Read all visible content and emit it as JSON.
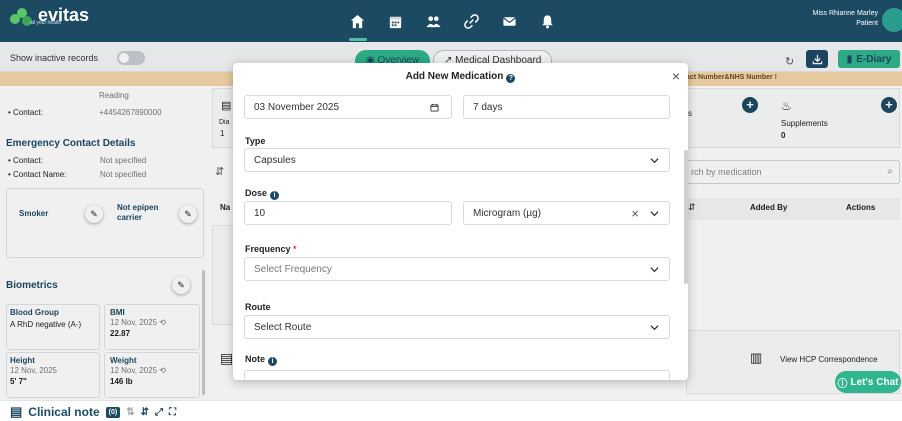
{
  "header": {
    "logo_text": "evitas",
    "logo_tagline": "all your health",
    "nav_icons": [
      "home-icon",
      "calendar-icon",
      "users-icon",
      "link-icon",
      "mail-icon",
      "bell-icon"
    ],
    "user_name": "Miss Rhianne Marley",
    "user_role": "Patient"
  },
  "subbar": {
    "inactive_label": "Show inactive records",
    "tab_overview": "Overview",
    "tab_medical": "Medical Dashboard",
    "ediary": "E-Diary"
  },
  "notice": {
    "text": "act Number&NHS Number !"
  },
  "left_panel": {
    "city": "Reading",
    "contact_label": "Contact:",
    "contact_value": "+4454267890000",
    "emergency_title": "Emergency Contact Details",
    "ec_contact_label": "Contact:",
    "ec_contact_value": "Not specified",
    "ec_name_label": "Contact Name:",
    "ec_name_value": "Not specified",
    "smoker": "Smoker",
    "epipen": "Not epipen carrier",
    "biometrics_title": "Biometrics",
    "blood_group_label": "Blood Group",
    "blood_group_value": "A RhD negative (A-)",
    "bmi_label": "BMI",
    "bmi_date": "12 Nov, 2025",
    "bmi_value": "22.87",
    "height_label": "Height",
    "height_date": "12 Nov, 2025",
    "height_value": "5' 7\"",
    "weight_label": "Weight",
    "weight_date": "12 Nov, 2025",
    "weight_value": "146 lb"
  },
  "middle_partial": {
    "dia": "Dia",
    "one": "1",
    "na": "Na"
  },
  "right_panel": {
    "s_partial": "s",
    "supplements_label": "Supplements",
    "supplements_count": "0",
    "search_placeholder": "rch by medication",
    "col_added_by": "Added By",
    "col_actions": "Actions",
    "hcp": "View HCP Correspondence"
  },
  "modal": {
    "title": "Add New Medication",
    "date_value": "03 November 2025",
    "duration_value": "7 days",
    "type_label": "Type",
    "type_value": "Capsules",
    "dose_label": "Dose",
    "dose_value": "10",
    "dose_unit": "Microgram (µg)",
    "frequency_label": "Frequency",
    "frequency_required": "*",
    "frequency_placeholder": "Select Frequency",
    "route_label": "Route",
    "route_placeholder": "Select Route",
    "note_label": "Note"
  },
  "bottom": {
    "clinical_note": "Clinical note",
    "count": "(0)",
    "lets_chat": "Let's Chat"
  }
}
